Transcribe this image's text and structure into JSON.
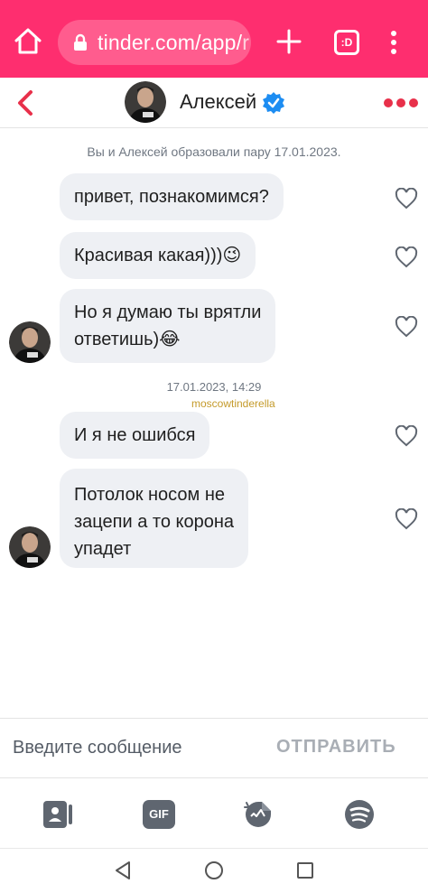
{
  "browser": {
    "url_main": "tinder.com/app/",
    "url_fade": "r",
    "tabs_label": ":D"
  },
  "header": {
    "contact_name": "Алексей"
  },
  "chat": {
    "match_note": "Вы и Алексей образовали пару 17.01.2023.",
    "messages": [
      {
        "text": "привет, познакомимся?"
      },
      {
        "text": "Красивая какая)))😉"
      },
      {
        "text": "Но я думаю ты врятли\nответишь)😂"
      },
      {
        "text": "И я не ошибся"
      },
      {
        "text": "Потолок носом не\nзацепи а то корона\nупадет"
      }
    ],
    "timestamp": "17.01.2023, 14:29",
    "watermark": "moscowtinderella"
  },
  "composer": {
    "placeholder": "Введите сообщение",
    "send_label": "ОТПРАВИТЬ"
  },
  "toolbar": {
    "gif_label": "GIF"
  },
  "icons": [
    "home-icon",
    "lock-icon",
    "plus-icon",
    "tabs-icon",
    "more-vert-icon",
    "back-icon",
    "verified-icon",
    "more-horiz-icon",
    "heart-icon",
    "contact-card-icon",
    "gif-icon",
    "sticker-icon",
    "spotify-icon",
    "nav-back-icon",
    "nav-home-icon",
    "nav-recents-icon"
  ],
  "colors": {
    "brand": "#fe2e6f",
    "back_arrow": "#e8304a",
    "verified": "#1d8df2",
    "bubble": "#eef0f4"
  }
}
